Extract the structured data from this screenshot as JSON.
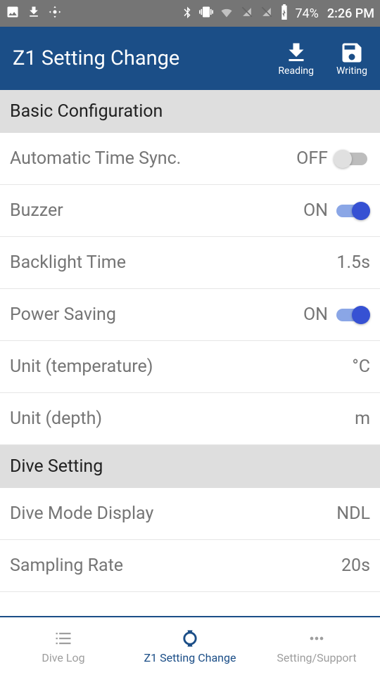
{
  "statusbar": {
    "battery_pct": "74%",
    "clock": "2:26 PM"
  },
  "appbar": {
    "title": "Z1 Setting Change",
    "reading_label": "Reading",
    "writing_label": "Writing"
  },
  "sections": {
    "basic": {
      "header": "Basic Configuration",
      "items": {
        "auto_time_sync": {
          "label": "Automatic Time Sync.",
          "value": "OFF",
          "toggle": false
        },
        "buzzer": {
          "label": "Buzzer",
          "value": "ON",
          "toggle": true
        },
        "backlight": {
          "label": "Backlight Time",
          "value": "1.5s"
        },
        "power_saving": {
          "label": "Power Saving",
          "value": "ON",
          "toggle": true
        },
        "unit_temp": {
          "label": "Unit (temperature)",
          "value": "°C"
        },
        "unit_depth": {
          "label": "Unit (depth)",
          "value": "m"
        }
      }
    },
    "dive": {
      "header": "Dive Setting",
      "items": {
        "dive_mode": {
          "label": "Dive Mode Display",
          "value": "NDL"
        },
        "sampling": {
          "label": "Sampling Rate",
          "value": "20s"
        }
      }
    }
  },
  "bottom_nav": {
    "dive_log": "Dive Log",
    "z1_setting": "Z1 Setting Change",
    "setting_support": "Setting/Support"
  }
}
